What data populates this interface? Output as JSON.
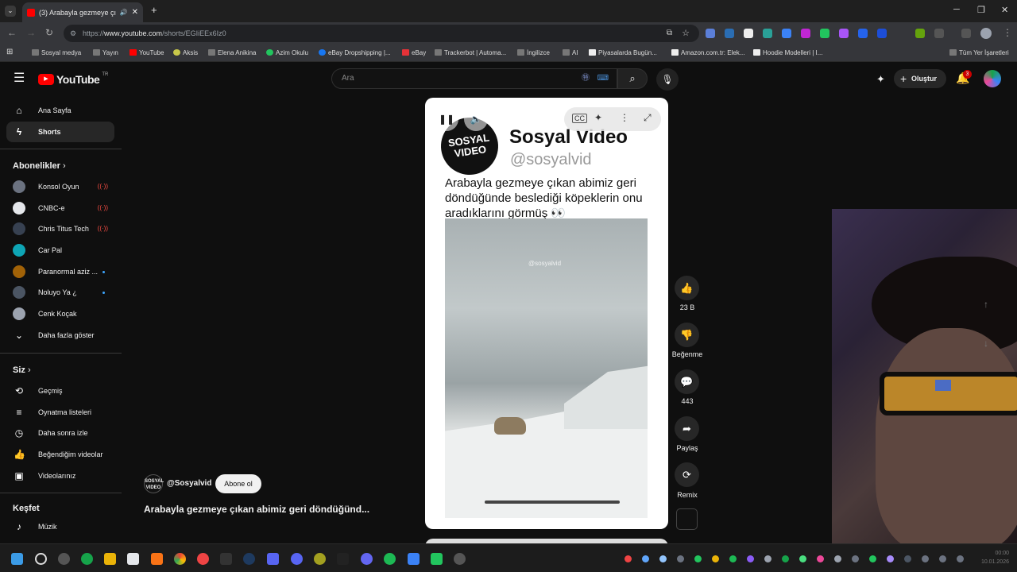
{
  "browser": {
    "tab_title": "(3) Arabayla gezmeye çıkan",
    "url_prefix": "https://",
    "url_domain": "www.youtube.com",
    "url_path": "/shorts/EGIiEEx6Iz0",
    "bookmarks": [
      "Sosyal medya",
      "Yayın",
      "YouTube",
      "Aksis",
      "Elena Anikina",
      "Azim Okulu",
      "eBay Dropshipping |...",
      "eBay",
      "Trackerbot | Automa...",
      "İngilizce",
      "AI",
      "Piyasalarda Bugün...",
      "Amazon.com.tr: Elek...",
      "Hoodie Modelleri | I...",
      "Tüm Yer İşaretleri"
    ]
  },
  "youtube": {
    "logo_text": "YouTube",
    "logo_region": "TR",
    "search_placeholder": "Ara",
    "create_label": "Oluştur",
    "notif_count": "3"
  },
  "sidebar": {
    "home": "Ana Sayfa",
    "shorts": "Shorts",
    "subs_header": "Abonelikler",
    "subscriptions": [
      {
        "name": "Konsol Oyun",
        "status": "live"
      },
      {
        "name": "CNBC-e",
        "status": "live"
      },
      {
        "name": "Chris Titus Tech",
        "status": "live"
      },
      {
        "name": "Car Pal",
        "status": ""
      },
      {
        "name": "Paranormal aziz ...",
        "status": "new"
      },
      {
        "name": "Noluyo Ya ¿",
        "status": "new"
      },
      {
        "name": "Cenk Koçak",
        "status": ""
      }
    ],
    "show_more": "Daha fazla göster",
    "you_header": "Siz",
    "you_items": [
      "Geçmiş",
      "Oynatma listeleri",
      "Daha sonra izle",
      "Beğendiğim videolar",
      "Videolarınız"
    ],
    "explore_header": "Keşfet",
    "explore_items": [
      "Müzik"
    ]
  },
  "short": {
    "logo_line1": "SOSYAL",
    "logo_line2": "VIDEO",
    "channel_title": "Sosyal Video",
    "channel_handle": "@sosyalvid",
    "caption": "Arabayla gezmeye çıkan abimiz geri döndüğünde beslediği köpeklerin onu aradıklarını görmüş 👀",
    "watermark": "@sosyalvid",
    "overlay_handle": "@Sosyalvid",
    "subscribe_label": "Abone ol",
    "title": "Arabayla gezmeye çıkan abimiz geri döndüğünd..."
  },
  "actions": {
    "likes": "23 B",
    "dislike_label": "Beğenme",
    "comments": "443",
    "share_label": "Paylaş",
    "remix_label": "Remix"
  },
  "taskbar": {
    "time": "00:00",
    "date": "10.01.2026"
  }
}
